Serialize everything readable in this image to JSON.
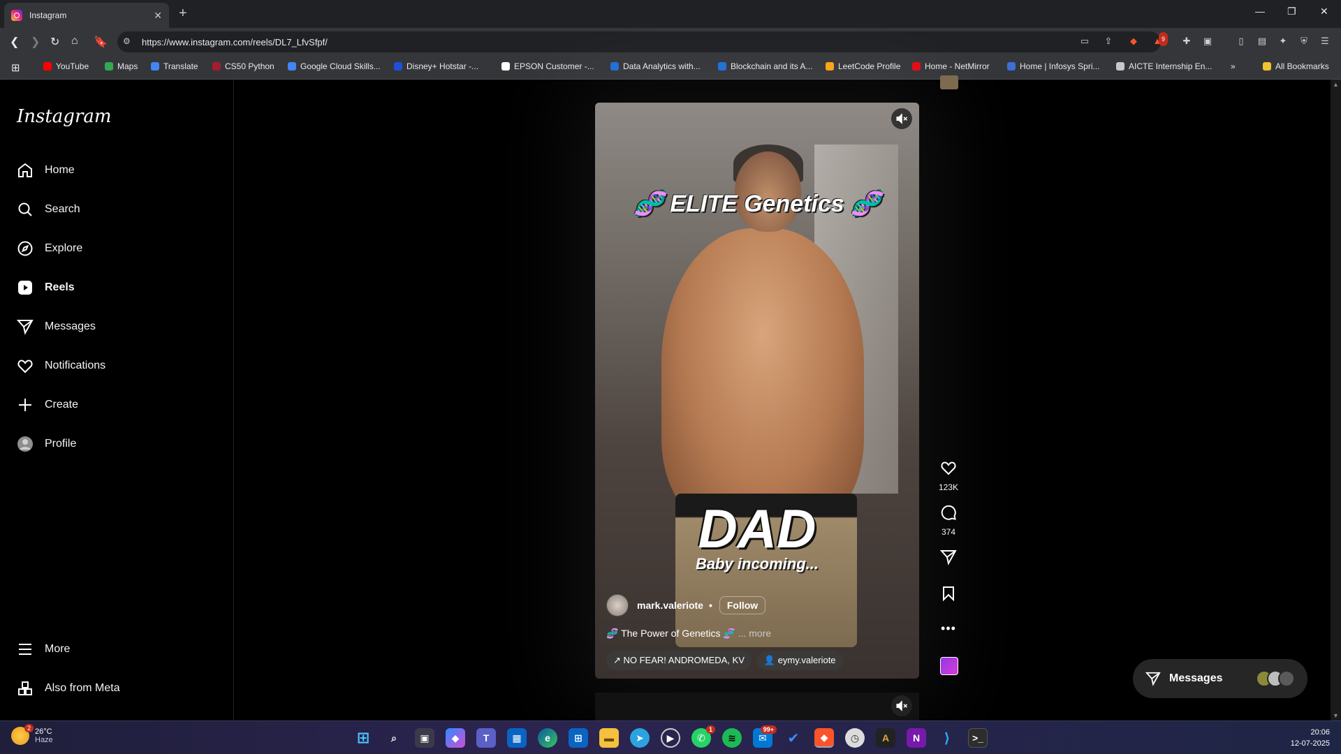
{
  "browser": {
    "tab_title": "Instagram",
    "url": "https://www.instagram.com/reels/DL7_LfvSfpf/",
    "extension_badge": "9",
    "bookmarks": [
      {
        "label": "YouTube",
        "color": "#ff0000"
      },
      {
        "label": "Maps",
        "color": "#34a853"
      },
      {
        "label": "Translate",
        "color": "#4285f4"
      },
      {
        "label": "CS50 Python",
        "color": "#a51c30"
      },
      {
        "label": "Google Cloud Skills...",
        "color": "#4285f4"
      },
      {
        "label": "Disney+ Hotstar -...",
        "color": "#1f4fd6"
      },
      {
        "label": "EPSON Customer -...",
        "color": "#ffffff"
      },
      {
        "label": "Data Analytics with...",
        "color": "#1f6fd6"
      },
      {
        "label": "Blockchain and its A...",
        "color": "#1f6fd6"
      },
      {
        "label": "LeetCode Profile",
        "color": "#ffa116"
      },
      {
        "label": "Home - NetMirror",
        "color": "#e50914"
      },
      {
        "label": "Home | Infosys Spri...",
        "color": "#3d6fd6"
      },
      {
        "label": "AICTE Internship En...",
        "color": "#c8c8c8"
      }
    ],
    "all_bookmarks": "All Bookmarks"
  },
  "instagram": {
    "logo": "Instagram",
    "nav": [
      {
        "label": "Home",
        "icon": "home-icon"
      },
      {
        "label": "Search",
        "icon": "search-icon"
      },
      {
        "label": "Explore",
        "icon": "compass-icon"
      },
      {
        "label": "Reels",
        "icon": "reels-icon"
      },
      {
        "label": "Messages",
        "icon": "send-icon"
      },
      {
        "label": "Notifications",
        "icon": "heart-icon"
      },
      {
        "label": "Create",
        "icon": "plus-icon"
      },
      {
        "label": "Profile",
        "icon": "avatar"
      }
    ],
    "more": "More",
    "also_from_meta": "Also from Meta",
    "reel": {
      "overlay_title": "🧬 ELITE Genetics 🧬",
      "overlay_main": "DAD",
      "overlay_sub": "Baby incoming...",
      "username": "mark.valeriote",
      "separator": "•",
      "follow": "Follow",
      "caption": "🧬 The Power of Genetics 🧬",
      "caption_more": "... more",
      "audio": "↗ NO FEAR!  ANDROMEDA, KV",
      "tagged_user": "eymy.valeriote",
      "likes": "123K",
      "comments": "374"
    },
    "messages_pill": "Messages"
  },
  "taskbar": {
    "temperature": "26°C",
    "condition": "Haze",
    "weather_badge": "2",
    "whatsapp_badge": "1",
    "chat_badge": "99+",
    "time": "20:06",
    "date": "12-07-2025"
  }
}
